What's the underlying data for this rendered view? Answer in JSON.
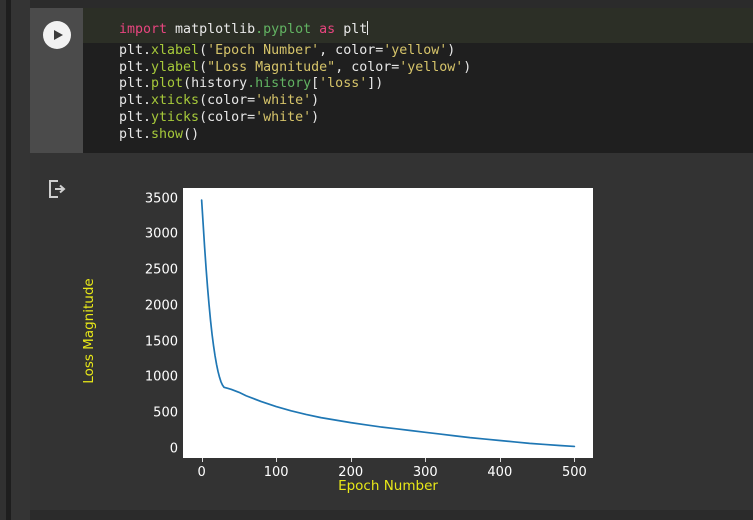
{
  "notebook": {
    "run_button_icon": "play-icon",
    "output_icon": "output-arrow-icon",
    "code_lines": [
      {
        "active": true,
        "tokens": [
          {
            "t": "import",
            "c": "kw"
          },
          {
            "t": " matplotlib",
            "c": "plain"
          },
          {
            "t": ".pyplot",
            "c": "attr"
          },
          {
            "t": " ",
            "c": "plain"
          },
          {
            "t": "as",
            "c": "kw"
          },
          {
            "t": " plt",
            "c": "plain"
          }
        ],
        "caret": true
      },
      {
        "active": false,
        "tokens": [
          {
            "t": "plt.",
            "c": "plain"
          },
          {
            "t": "xlabel",
            "c": "fn"
          },
          {
            "t": "(",
            "c": "plain"
          },
          {
            "t": "'Epoch Number'",
            "c": "str"
          },
          {
            "t": ", color=",
            "c": "plain"
          },
          {
            "t": "'yellow'",
            "c": "str"
          },
          {
            "t": ")",
            "c": "plain"
          }
        ],
        "caret": false
      },
      {
        "active": false,
        "tokens": [
          {
            "t": "plt.",
            "c": "plain"
          },
          {
            "t": "ylabel",
            "c": "fn"
          },
          {
            "t": "(",
            "c": "plain"
          },
          {
            "t": "\"Loss Magnitude\"",
            "c": "str"
          },
          {
            "t": ", color=",
            "c": "plain"
          },
          {
            "t": "'yellow'",
            "c": "str"
          },
          {
            "t": ")",
            "c": "plain"
          }
        ],
        "caret": false
      },
      {
        "active": false,
        "tokens": [
          {
            "t": "plt.",
            "c": "plain"
          },
          {
            "t": "plot",
            "c": "fn"
          },
          {
            "t": "(history",
            "c": "plain"
          },
          {
            "t": ".history",
            "c": "attr"
          },
          {
            "t": "[",
            "c": "plain"
          },
          {
            "t": "'loss'",
            "c": "str"
          },
          {
            "t": "])",
            "c": "plain"
          }
        ],
        "caret": false
      },
      {
        "active": false,
        "tokens": [
          {
            "t": "plt.",
            "c": "plain"
          },
          {
            "t": "xticks",
            "c": "fn"
          },
          {
            "t": "(color=",
            "c": "plain"
          },
          {
            "t": "'white'",
            "c": "str"
          },
          {
            "t": ")",
            "c": "plain"
          }
        ],
        "caret": false
      },
      {
        "active": false,
        "tokens": [
          {
            "t": "plt.",
            "c": "plain"
          },
          {
            "t": "yticks",
            "c": "fn"
          },
          {
            "t": "(color=",
            "c": "plain"
          },
          {
            "t": "'white'",
            "c": "str"
          },
          {
            "t": ")",
            "c": "plain"
          }
        ],
        "caret": false
      },
      {
        "active": false,
        "tokens": [
          {
            "t": "plt.",
            "c": "plain"
          },
          {
            "t": "show",
            "c": "fn"
          },
          {
            "t": "()",
            "c": "plain"
          }
        ],
        "caret": false
      }
    ]
  },
  "chart_data": {
    "type": "line",
    "title": "",
    "xlabel": "Epoch Number",
    "ylabel": "Loss Magnitude",
    "xlim": [
      -25,
      525
    ],
    "ylim": [
      -130,
      3650
    ],
    "xticks": [
      0,
      100,
      200,
      300,
      400,
      500
    ],
    "yticks": [
      0,
      500,
      1000,
      1500,
      2000,
      2500,
      3000,
      3500
    ],
    "grid": false,
    "legend": null,
    "line_color": "#1f77b4",
    "tick_color": "#ffffff",
    "label_color": "#ffff00",
    "axes_facecolor": "#ffffff",
    "series": [
      {
        "name": "loss",
        "x": [
          0,
          2,
          4,
          6,
          8,
          10,
          12,
          14,
          16,
          18,
          20,
          22,
          24,
          26,
          28,
          30,
          35,
          40,
          50,
          60,
          70,
          80,
          90,
          100,
          120,
          140,
          160,
          180,
          200,
          220,
          240,
          260,
          280,
          300,
          320,
          340,
          360,
          380,
          400,
          420,
          440,
          460,
          480,
          500
        ],
        "y": [
          3480,
          3150,
          2820,
          2520,
          2250,
          2010,
          1790,
          1600,
          1440,
          1300,
          1180,
          1080,
          1000,
          935,
          890,
          860,
          845,
          830,
          790,
          740,
          700,
          660,
          625,
          590,
          530,
          480,
          435,
          400,
          365,
          335,
          305,
          280,
          255,
          230,
          205,
          180,
          155,
          135,
          115,
          95,
          75,
          60,
          45,
          32
        ]
      }
    ]
  }
}
